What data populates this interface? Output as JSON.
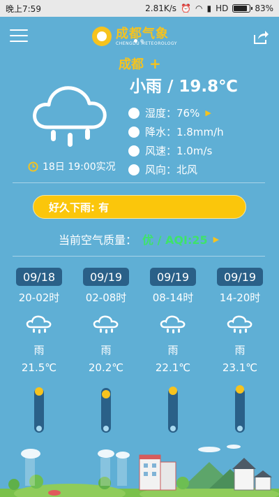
{
  "status": {
    "time": "晚上7:59",
    "speed": "2.81K/s",
    "network": "HD",
    "battery": "83%",
    "battery_level": 0.83
  },
  "app": {
    "logo_cn": "成都气象",
    "logo_en": "CHENGDU METEOROLOGY",
    "page_count": 2,
    "active_page": 1
  },
  "current": {
    "city": "成都",
    "city_add": "+",
    "condition": "小雨 / 19.8℃",
    "obs_time": "18日 19:00实况",
    "humidity": "湿度：76%",
    "rain": "降水：1.8mm/h",
    "wind_speed": "风速：1.0m/s",
    "wind_dir": "风向：北风"
  },
  "alert": {
    "text": "好久下雨: 有"
  },
  "aqi": {
    "label": "当前空气质量：",
    "value": "优 / AQI:25"
  },
  "forecast": [
    {
      "date": "09/18",
      "range": "20-02时",
      "weather": "雨",
      "temp": "21.5℃",
      "temp_value": 21.5
    },
    {
      "date": "09/19",
      "range": "02-08时",
      "weather": "雨",
      "temp": "20.2℃",
      "temp_value": 20.2
    },
    {
      "date": "09/19",
      "range": "08-14时",
      "weather": "雨",
      "temp": "22.1℃",
      "temp_value": 22.1
    },
    {
      "date": "09/19",
      "range": "14-20时",
      "weather": "雨",
      "temp": "23.1℃",
      "temp_value": 23.1
    }
  ],
  "colors": {
    "background": "#5FAFD5",
    "accent": "#F6C31E",
    "alert_bg": "#FBC60B",
    "aqi_good": "#3EE36A",
    "date_chip": "#2A6088"
  }
}
